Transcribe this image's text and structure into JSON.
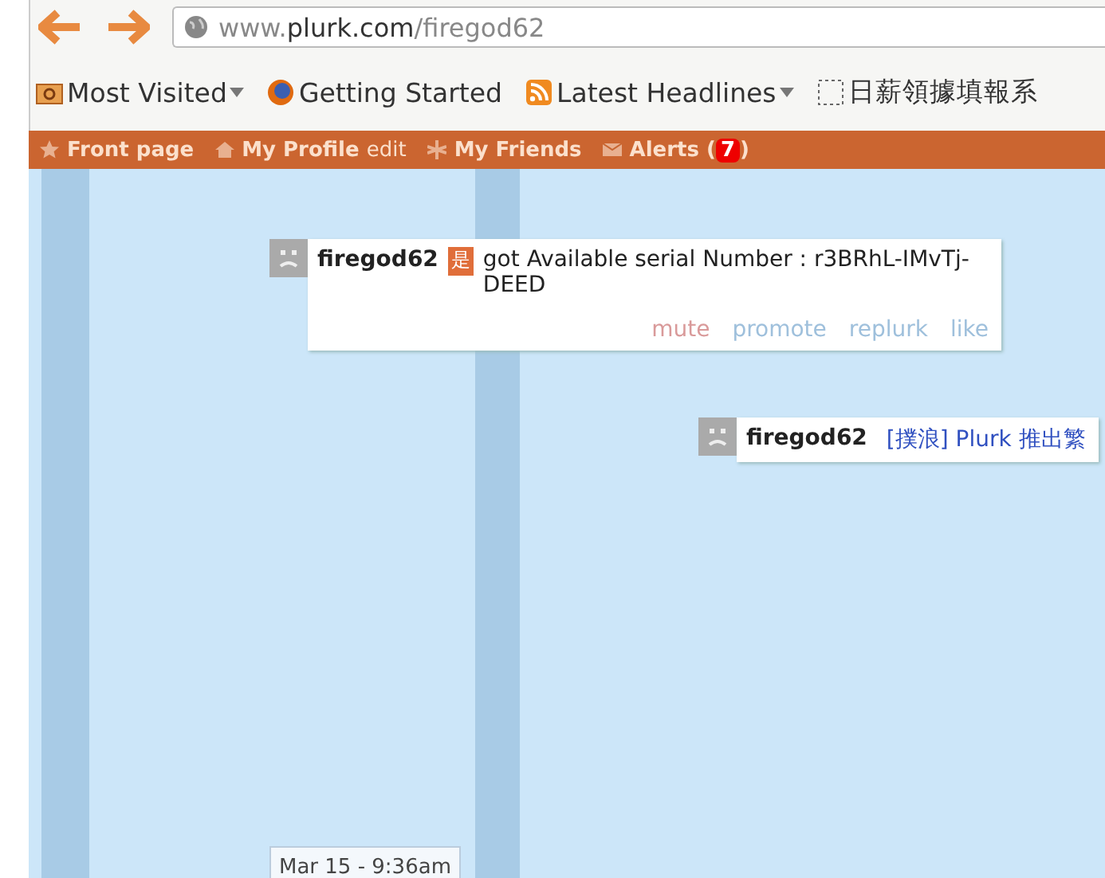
{
  "browser": {
    "url": {
      "prefix": "www.",
      "domain": "plurk.com",
      "path": "/firegod62"
    },
    "bookmarks": [
      {
        "label": "Most Visited",
        "kind": "folder",
        "dropdown": true
      },
      {
        "label": "Getting Started",
        "kind": "globe",
        "dropdown": false
      },
      {
        "label": "Latest Headlines",
        "kind": "feed",
        "dropdown": true
      },
      {
        "label": "日薪領據填報系",
        "kind": "blank",
        "dropdown": false
      }
    ]
  },
  "nav": [
    {
      "label": "Front page",
      "kind": "star"
    },
    {
      "label": "My Profile",
      "extra": "edit",
      "kind": "home"
    },
    {
      "label": "My Friends",
      "kind": "friends"
    },
    {
      "label": "Alerts (",
      "badge": "7",
      "suffix": ")",
      "kind": "mail"
    }
  ],
  "plurks": [
    {
      "user": "firegod62",
      "qualifier": "是",
      "text": "got Available serial Number : r3BRhL-IMvTj-DEED",
      "kind": "plain",
      "actions": [
        {
          "label": "mute",
          "color": "#d99a9a"
        },
        {
          "label": "promote",
          "color": "#9fc0dc"
        },
        {
          "label": "replurk",
          "color": "#9fc0dc"
        },
        {
          "label": "like",
          "color": "#9fc0dc"
        }
      ]
    },
    {
      "user": "firegod62",
      "text": "[撲浪] Plurk 推出繁",
      "kind": "link"
    }
  ],
  "timestamp": "Mar 15 - 9:36am"
}
